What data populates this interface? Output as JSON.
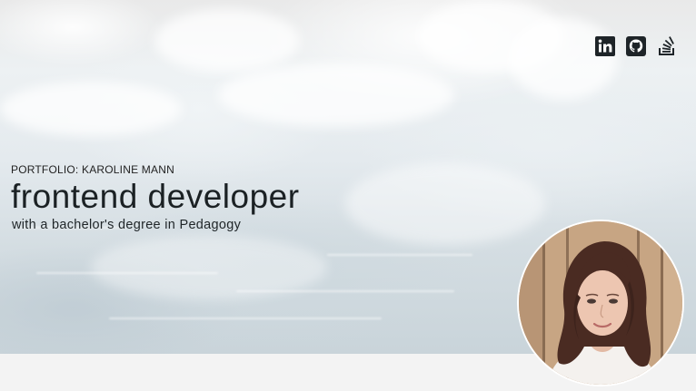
{
  "header": {
    "portfolio_label": "PORTFOLIO: KAROLINE MANN",
    "title": "frontend developer",
    "subtitle": "with a bachelor's degree in Pedagogy"
  },
  "social": [
    {
      "icon": "linkedin-icon"
    },
    {
      "icon": "github-icon"
    },
    {
      "icon": "stackoverflow-icon"
    }
  ],
  "colors": {
    "text": "#1b2124",
    "icon": "#1e2428",
    "footer_band": "#f3f3f3"
  }
}
